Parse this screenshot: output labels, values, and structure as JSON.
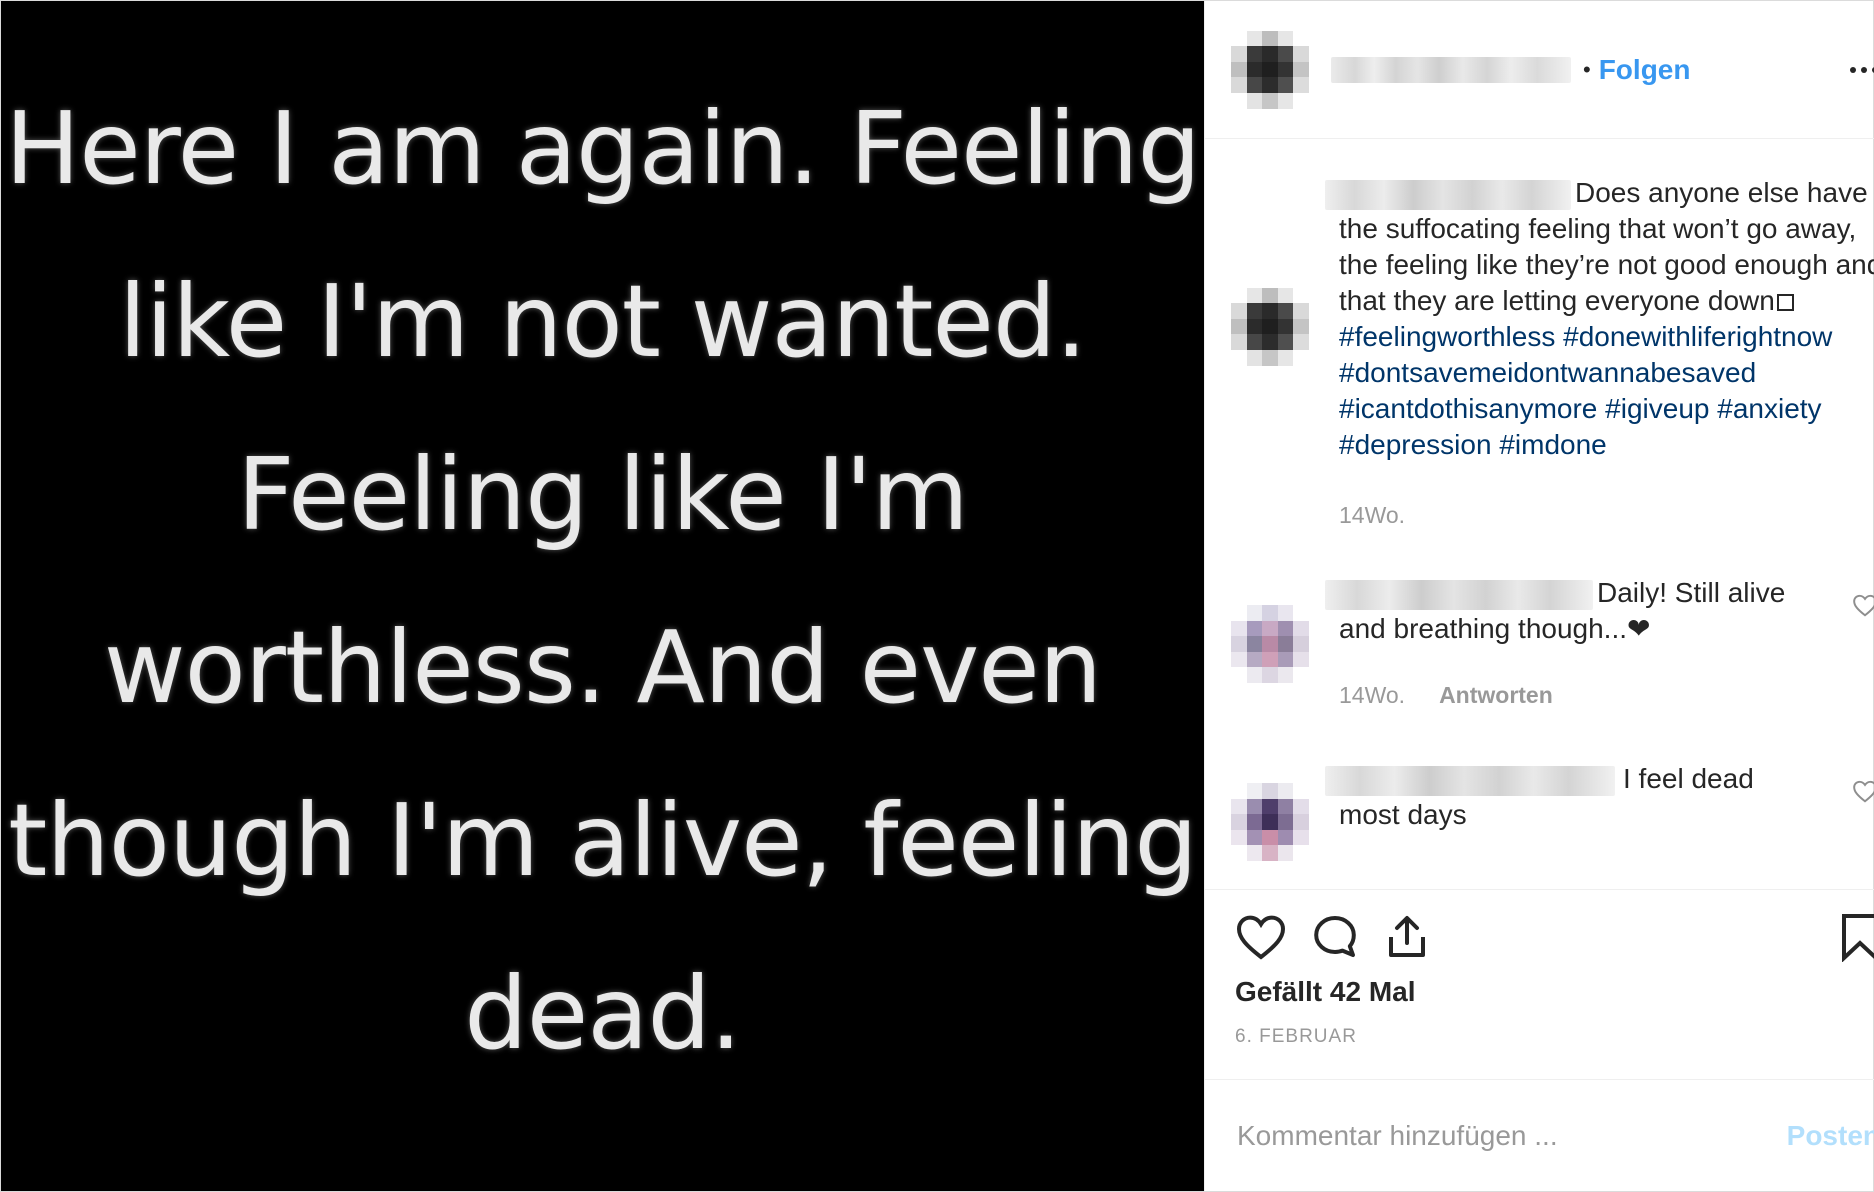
{
  "image": {
    "lines": [
      "Here I am again. Feeling",
      "like I'm not wanted.",
      "Feeling like I'm",
      "worthless. And even",
      "though I'm alive, feeling",
      "dead."
    ]
  },
  "header": {
    "follow_label": "Folgen",
    "more_icon": "more-horizontal-icon"
  },
  "caption": {
    "text_before": "Does anyone else have the suffocating feeling that won’t go away, the feeling like they’re not good enough and that they are letting everyone down",
    "hashtags": [
      "#feelingworthless",
      "#donewithliferightnow",
      "#dontsavemeidontwannabesaved",
      "#icantdothisanymore",
      "#igiveup",
      "#anxiety",
      "#depression",
      "#imdone"
    ],
    "time": "14Wo."
  },
  "comments": [
    {
      "text": "Daily! Still alive and breathing though...❤",
      "time": "14Wo.",
      "reply_label": "Antworten"
    },
    {
      "text": "I feel dead most days"
    }
  ],
  "actions": {
    "likes": "Gefällt 42 Mal",
    "date": "6. FEBRUAR"
  },
  "comment_box": {
    "placeholder": "Kommentar hinzufügen ...",
    "post_label": "Posten"
  },
  "colors": {
    "link_blue": "#3897f0",
    "hashtag": "#003569",
    "muted": "#999999",
    "post_disabled": "#b2dffc"
  }
}
